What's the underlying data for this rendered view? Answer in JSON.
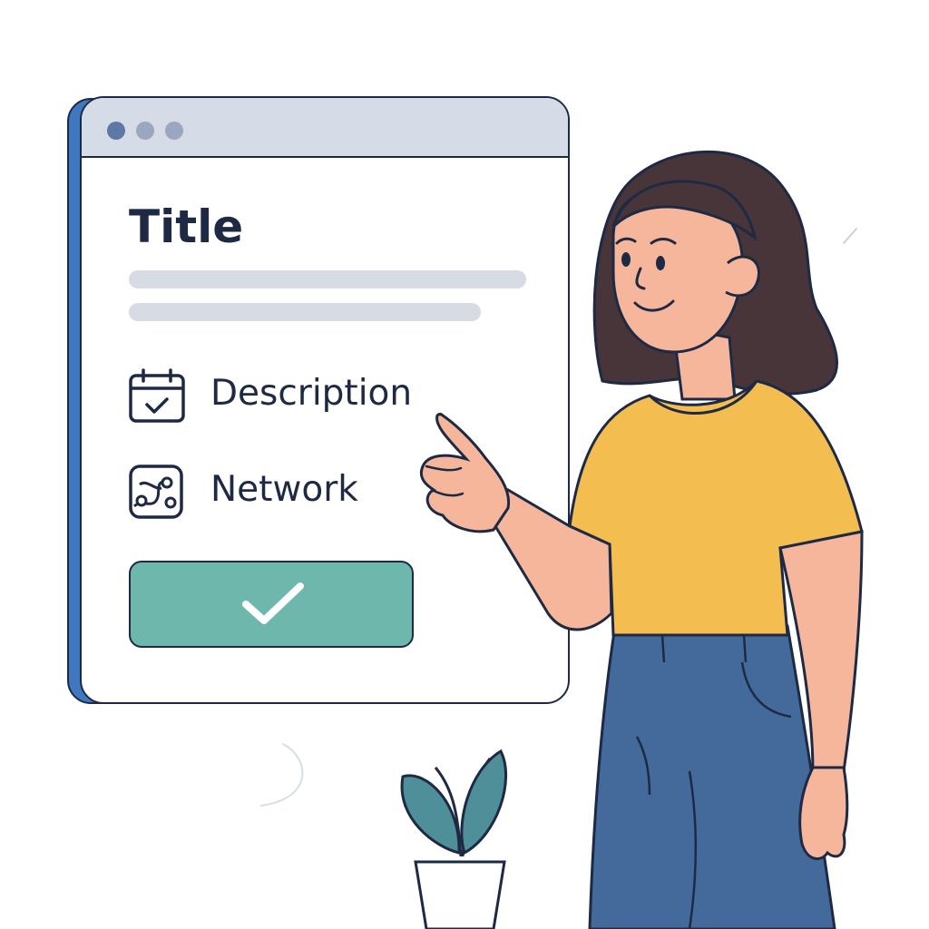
{
  "window": {
    "title": "Title",
    "rows": [
      {
        "label": "Description",
        "icon": "calendar-check-icon"
      },
      {
        "label": "Network",
        "icon": "network-route-icon"
      }
    ],
    "confirm_button": {
      "icon": "checkmark-icon"
    }
  },
  "colors": {
    "accent": "#6db7ad",
    "outline": "#1e2a44",
    "titlebar": "#d6dce7",
    "window_back_edge": "#3f78bf",
    "shirt": "#f4bd50",
    "jeans": "#436a9b",
    "hair": "#47353a",
    "skin": "#f5b69b",
    "plant": "#4f8f99"
  }
}
